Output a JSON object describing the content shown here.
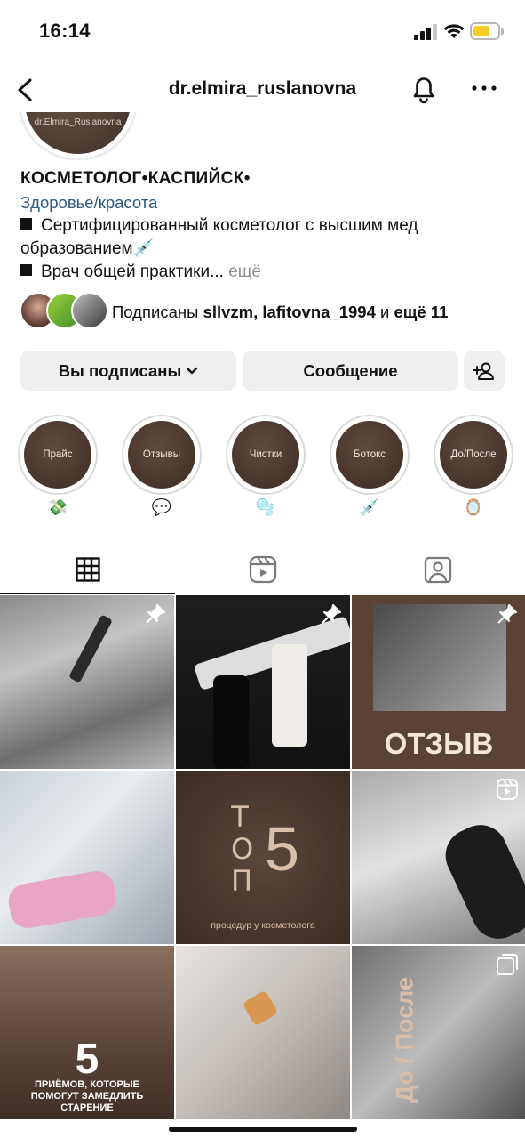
{
  "status_bar": {
    "time": "16:14"
  },
  "nav": {
    "username": "dr.elmira_ruslanovna"
  },
  "avatar": {
    "name_text": "dr.Elmira_Ruslanovna"
  },
  "bio": {
    "name": "КОСМЕТОЛОГ•КАСПИЙСК•",
    "category": "Здоровье/красота",
    "line1": "Сертифицированный косметолог с высшим мед",
    "line2": "образованием💉",
    "line3": "Врач общей практики...",
    "more": "ещё"
  },
  "followed_by": {
    "prefix": "Подписаны ",
    "users": "sllvzm, lafitovna_1994",
    "middle": " и ",
    "more": "ещё 11"
  },
  "buttons": {
    "following": "Вы подписаны",
    "message": "Сообщение"
  },
  "highlights": [
    {
      "label": "Прайс",
      "emoji": "💸"
    },
    {
      "label": "Отзывы",
      "emoji": "💬"
    },
    {
      "label": "Чистки",
      "emoji": "🫧"
    },
    {
      "label": "Ботокс",
      "emoji": "💉"
    },
    {
      "label": "До/После",
      "emoji": "🪞"
    }
  ],
  "posts": [
    {
      "text": ""
    },
    {
      "text": ""
    },
    {
      "text": "ОТЗЫВ"
    },
    {
      "text": ""
    },
    {
      "text": "процедур у косметолога",
      "big": "5"
    },
    {
      "text": ""
    },
    {
      "text": "ПРИЁМОВ, КОТОРЫЕ ПОМОГУТ ЗАМЕДЛИТЬ СТАРЕНИЕ",
      "big": "5"
    },
    {
      "text": ""
    },
    {
      "text": "До / После"
    }
  ],
  "colors": {
    "link": "#2b5a84",
    "muted": "#8e8e8e",
    "button_bg": "#efefef",
    "highlight_bg": "#4a3a30",
    "battery": "#f7cc27"
  }
}
